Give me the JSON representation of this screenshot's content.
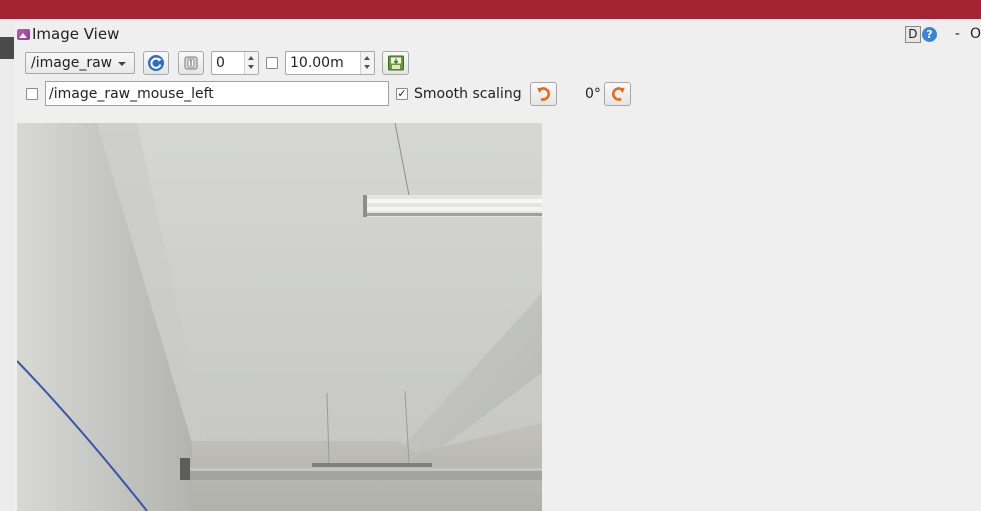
{
  "window": {
    "title": "Image View",
    "d_button": "D",
    "help_icon": "?",
    "minimize_label": "-",
    "close_label": "O"
  },
  "toolbar": {
    "topic": "/image_raw",
    "value_spin": "0",
    "time_spin": "10.00m",
    "mouse_topic": "/image_raw_mouse_left",
    "smooth_scaling_label": "Smooth scaling",
    "smooth_scaling_checked": "✓",
    "rotation": "0°"
  },
  "icons": {
    "refresh": "refresh-icon",
    "zoom_1": "zoom-1-icon",
    "save": "save-icon",
    "rotate_left": "rotate-left-icon",
    "rotate_right": "rotate-right-icon"
  },
  "colors": {
    "titlebar": "#a52232",
    "panel_bg": "#efefef",
    "accent_blue": "#3a86d6",
    "rotate_orange": "#e36b1a"
  }
}
